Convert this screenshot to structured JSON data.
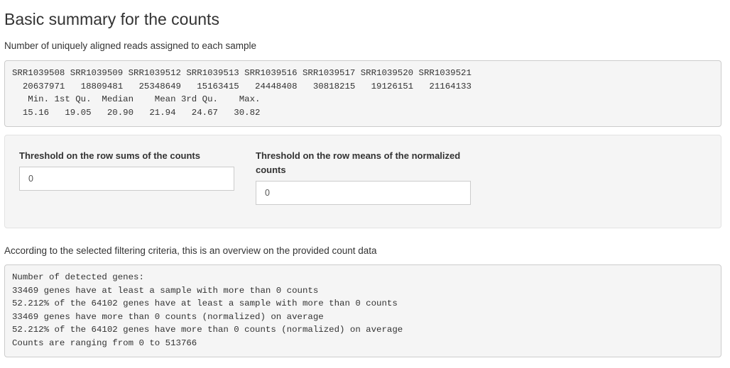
{
  "header": {
    "title": "Basic summary for the counts",
    "subtitle": "Number of uniquely aligned reads assigned to each sample"
  },
  "summary_output": {
    "lines": [
      "SRR1039508 SRR1039509 SRR1039512 SRR1039513 SRR1039516 SRR1039517 SRR1039520 SRR1039521",
      "  20637971   18809481   25348649   15163415   24448408   30818215   19126151   21164133",
      "   Min. 1st Qu.  Median    Mean 3rd Qu.    Max. ",
      "  15.16   19.05   20.90   21.94   24.67   30.82 "
    ]
  },
  "filters": {
    "row_sums": {
      "label": "Threshold on the row sums of the counts",
      "value": "0"
    },
    "row_means": {
      "label": "Threshold on the row means of the normalized counts",
      "value": "0"
    }
  },
  "overview": {
    "caption": "According to the selected filtering criteria, this is an overview on the provided count data",
    "lines": [
      "Number of detected genes:",
      "33469 genes have at least a sample with more than 0 counts",
      "52.212% of the 64102 genes have at least a sample with more than 0 counts",
      "33469 genes have more than 0 counts (normalized) on average",
      "52.212% of the 64102 genes have more than 0 counts (normalized) on average",
      "Counts are ranging from 0 to 513766"
    ]
  }
}
